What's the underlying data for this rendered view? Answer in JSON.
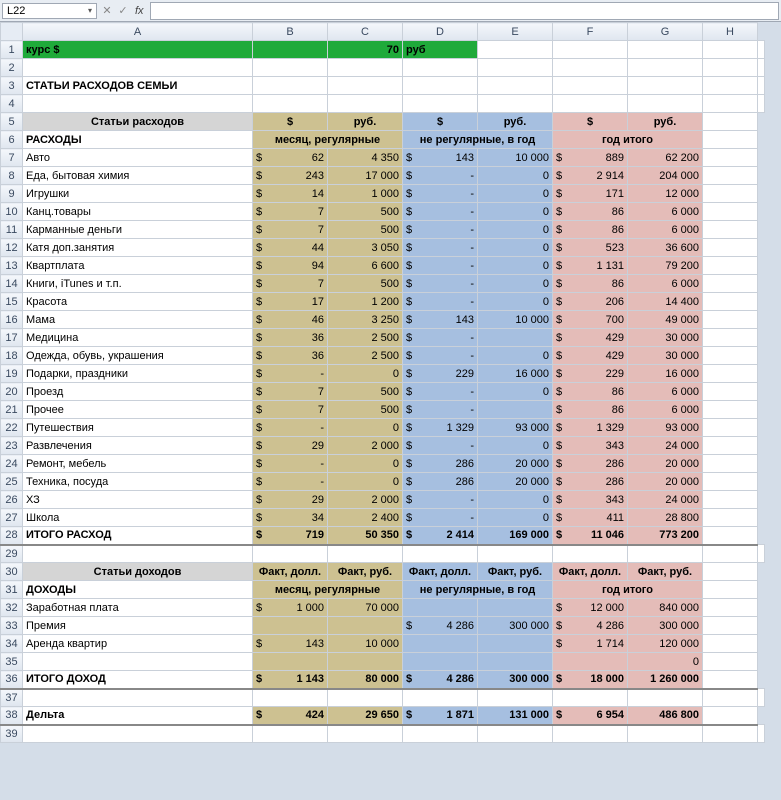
{
  "formulaBar": {
    "cellRef": "L22",
    "dropdown": "▾",
    "fx": "fx",
    "value": ""
  },
  "columns": [
    "A",
    "B",
    "C",
    "D",
    "E",
    "F",
    "G",
    "H"
  ],
  "row1": {
    "label": "курс $",
    "rate": "70",
    "unit": "руб"
  },
  "row3": {
    "title": "СТАТЬИ РАСХОДОВ СЕМЬИ"
  },
  "expHeader": {
    "col": "Статьи расходов",
    "b": "$",
    "c": "руб.",
    "d": "$",
    "e": "руб.",
    "f": "$",
    "g": "руб."
  },
  "expSubHeader": {
    "a": "РАСХОДЫ",
    "bc": "месяц, регулярные",
    "de": "не регулярные, в год",
    "fg": "год итого"
  },
  "expenses": [
    {
      "n": "Авто",
      "b": "62",
      "c": "4 350",
      "d": "143",
      "e": "10 000",
      "f": "889",
      "g": "62 200"
    },
    {
      "n": "Еда, бытовая химия",
      "b": "243",
      "c": "17 000",
      "d": "-",
      "e": "0",
      "f": "2 914",
      "g": "204 000"
    },
    {
      "n": "Игрушки",
      "b": "14",
      "c": "1 000",
      "d": "-",
      "e": "0",
      "f": "171",
      "g": "12 000"
    },
    {
      "n": "Канц.товары",
      "b": "7",
      "c": "500",
      "d": "-",
      "e": "0",
      "f": "86",
      "g": "6 000"
    },
    {
      "n": "Карманные деньги",
      "b": "7",
      "c": "500",
      "d": "-",
      "e": "0",
      "f": "86",
      "g": "6 000"
    },
    {
      "n": "Катя доп.занятия",
      "b": "44",
      "c": "3 050",
      "d": "-",
      "e": "0",
      "f": "523",
      "g": "36 600"
    },
    {
      "n": "Квартплата",
      "b": "94",
      "c": "6 600",
      "d": "-",
      "e": "0",
      "f": "1 131",
      "g": "79 200"
    },
    {
      "n": "Книги, iTunes и т.п.",
      "b": "7",
      "c": "500",
      "d": "-",
      "e": "0",
      "f": "86",
      "g": "6 000"
    },
    {
      "n": "Красота",
      "b": "17",
      "c": "1 200",
      "d": "-",
      "e": "0",
      "f": "206",
      "g": "14 400"
    },
    {
      "n": "Мама",
      "b": "46",
      "c": "3 250",
      "d": "143",
      "e": "10 000",
      "f": "700",
      "g": "49 000"
    },
    {
      "n": "Медицина",
      "b": "36",
      "c": "2 500",
      "d": "-",
      "e": "",
      "f": "429",
      "g": "30 000"
    },
    {
      "n": "Одежда, обувь, украшения",
      "b": "36",
      "c": "2 500",
      "d": "-",
      "e": "0",
      "f": "429",
      "g": "30 000"
    },
    {
      "n": "Подарки, праздники",
      "b": "-",
      "c": "0",
      "d": "229",
      "e": "16 000",
      "f": "229",
      "g": "16 000"
    },
    {
      "n": "Проезд",
      "b": "7",
      "c": "500",
      "d": "-",
      "e": "0",
      "f": "86",
      "g": "6 000"
    },
    {
      "n": "Прочее",
      "b": "7",
      "c": "500",
      "d": "-",
      "e": "",
      "f": "86",
      "g": "6 000"
    },
    {
      "n": "Путешествия",
      "b": "-",
      "c": "0",
      "d": "1 329",
      "e": "93 000",
      "f": "1 329",
      "g": "93 000"
    },
    {
      "n": "Развлечения",
      "b": "29",
      "c": "2 000",
      "d": "-",
      "e": "0",
      "f": "343",
      "g": "24 000"
    },
    {
      "n": "Ремонт, мебель",
      "b": "-",
      "c": "0",
      "d": "286",
      "e": "20 000",
      "f": "286",
      "g": "20 000"
    },
    {
      "n": "Техника, посуда",
      "b": "-",
      "c": "0",
      "d": "286",
      "e": "20 000",
      "f": "286",
      "g": "20 000"
    },
    {
      "n": "ХЗ",
      "b": "29",
      "c": "2 000",
      "d": "-",
      "e": "0",
      "f": "343",
      "g": "24 000"
    },
    {
      "n": "Школа",
      "b": "34",
      "c": "2 400",
      "d": "-",
      "e": "0",
      "f": "411",
      "g": "28 800"
    }
  ],
  "expTotal": {
    "n": "ИТОГО РАСХОД",
    "b": "719",
    "c": "50 350",
    "d": "2 414",
    "e": "169 000",
    "f": "11 046",
    "g": "773 200"
  },
  "incHeader": {
    "col": "Статьи доходов",
    "b": "Факт, долл.",
    "c": "Факт, руб.",
    "d": "Факт, долл.",
    "e": "Факт, руб.",
    "f": "Факт, долл.",
    "g": "Факт, руб."
  },
  "incSubHeader": {
    "a": "ДОХОДЫ",
    "bc": "месяц, регулярные",
    "de": "не регулярные, в год",
    "fg": "год итого"
  },
  "incomes": [
    {
      "n": "Заработная плата",
      "b": "1 000",
      "c": "70 000",
      "d": "",
      "e": "",
      "f": "12 000",
      "g": "840 000"
    },
    {
      "n": "Премия",
      "b": "",
      "c": "",
      "d": "4 286",
      "e": "300 000",
      "f": "4 286",
      "g": "300 000"
    },
    {
      "n": "Аренда квартир",
      "b": "143",
      "c": "10 000",
      "d": "",
      "e": "",
      "f": "1 714",
      "g": "120 000"
    },
    {
      "n": "",
      "b": "",
      "c": "",
      "d": "",
      "e": "",
      "f": "",
      "g": "0"
    }
  ],
  "incTotal": {
    "n": "ИТОГО ДОХОД",
    "b": "1 143",
    "c": "80 000",
    "d": "4 286",
    "e": "300 000",
    "f": "18 000",
    "g": "1 260 000"
  },
  "delta": {
    "n": "Дельта",
    "b": "424",
    "c": "29 650",
    "d": "1 871",
    "e": "131 000",
    "f": "6 954",
    "g": "486 800"
  },
  "sym": "$"
}
